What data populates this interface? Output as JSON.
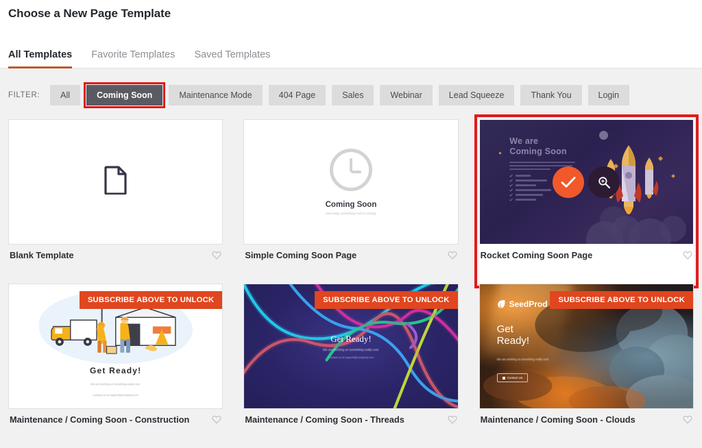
{
  "header": {
    "title": "Choose a New Page Template"
  },
  "tabs": [
    {
      "label": "All Templates",
      "active": true
    },
    {
      "label": "Favorite Templates",
      "active": false
    },
    {
      "label": "Saved Templates",
      "active": false
    }
  ],
  "filter": {
    "label": "FILTER:",
    "buttons": [
      {
        "label": "All",
        "active": false
      },
      {
        "label": "Coming Soon",
        "active": true,
        "highlighted": true
      },
      {
        "label": "Maintenance Mode",
        "active": false
      },
      {
        "label": "404 Page",
        "active": false
      },
      {
        "label": "Sales",
        "active": false
      },
      {
        "label": "Webinar",
        "active": false
      },
      {
        "label": "Lead Squeeze",
        "active": false
      },
      {
        "label": "Thank You",
        "active": false
      },
      {
        "label": "Login",
        "active": false
      }
    ]
  },
  "templates": [
    {
      "title": "Blank Template",
      "icon": "document-icon",
      "favorite": false,
      "locked": false,
      "highlighted": false
    },
    {
      "title": "Simple Coming Soon Page",
      "favorite": false,
      "locked": false,
      "highlighted": false,
      "preview": {
        "heading": "Coming Soon",
        "subtext": "Get ready, something cool is coming!"
      }
    },
    {
      "title": "Rocket Coming Soon Page",
      "favorite": false,
      "locked": false,
      "highlighted": true,
      "hovered": true,
      "preview": {
        "heading_line1": "We are",
        "heading_line2": "Coming Soon"
      },
      "actions": {
        "apply_label": "apply-template",
        "apply_icon": "checkmark-icon",
        "preview_label": "preview-template",
        "preview_icon": "magnifier-icon"
      }
    },
    {
      "title": "Maintenance / Coming Soon - Construction",
      "favorite": false,
      "locked": true,
      "lock_badge": "SUBSCRIBE ABOVE TO UNLOCK",
      "highlighted": false,
      "preview": {
        "heading": "Get  Ready!",
        "subtext": "We are working on something really cool.",
        "subtext2": "Contact us at support@company.com"
      }
    },
    {
      "title": "Maintenance / Coming Soon - Threads",
      "favorite": false,
      "locked": true,
      "lock_badge": "SUBSCRIBE ABOVE TO UNLOCK",
      "highlighted": false,
      "preview": {
        "heading": "Get Ready!",
        "subtext": "We are working on something really cool.",
        "subtext2": "Contact us at support@company.com"
      }
    },
    {
      "title": "Maintenance / Coming Soon - Clouds",
      "favorite": false,
      "locked": true,
      "lock_badge": "SUBSCRIBE ABOVE TO UNLOCK",
      "highlighted": false,
      "preview": {
        "brand": "SeedProd",
        "heading_line1": "Get",
        "heading_line2": "Ready!",
        "subtext": "We are working on something really cool.",
        "button": "Contact Us"
      }
    }
  ],
  "colors": {
    "accent_orange": "#f1592a",
    "tab_underline": "#bf5a2a",
    "highlight_red": "#e01b1b",
    "lock_badge": "#e0461f",
    "active_filter": "#5a5a63",
    "page_bg": "#f1f1f1"
  }
}
